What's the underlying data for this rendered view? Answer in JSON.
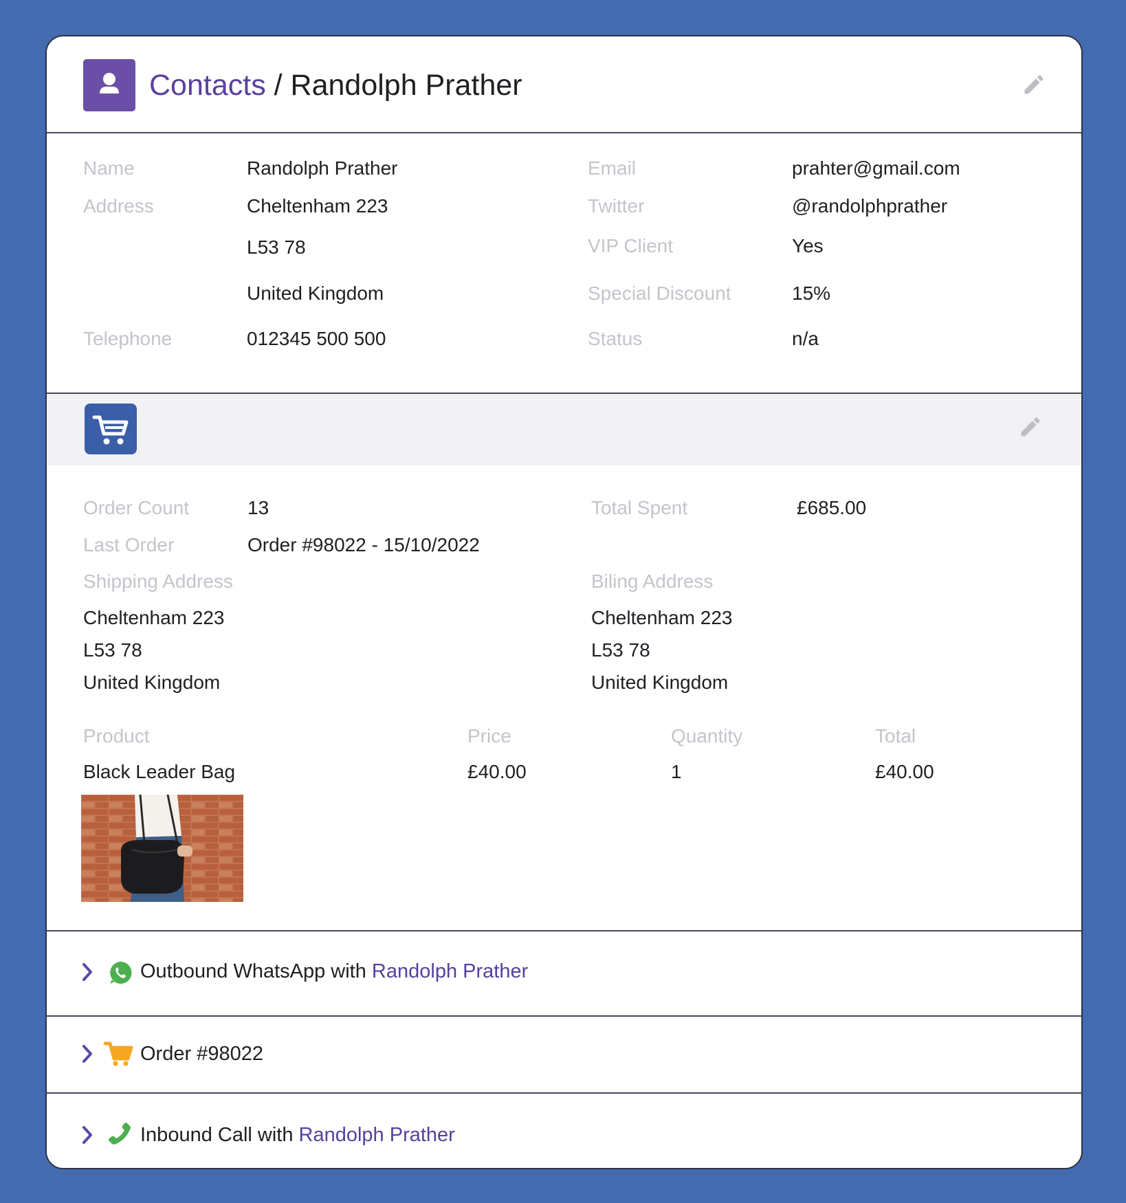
{
  "header": {
    "breadcrumb_root": "Contacts",
    "separator": " / ",
    "contact_name": "Randolph Prather"
  },
  "contact": {
    "name_label": "Name",
    "name_value": "Randolph Prather",
    "address_label": "Address",
    "address_line1": "Cheltenham 223",
    "address_line2": "L53 78",
    "address_line3": "United Kingdom",
    "telephone_label": "Telephone",
    "telephone_value": "012345 500 500",
    "email_label": "Email",
    "email_value": "prahter@gmail.com",
    "twitter_label": "Twitter",
    "twitter_value": "@randolphprather",
    "vip_label": "VIP Client",
    "vip_value": "Yes",
    "discount_label": "Special Discount",
    "discount_value": "15%",
    "status_label": "Status",
    "status_value": "n/a"
  },
  "orders": {
    "order_count_label": "Order Count",
    "order_count_value": "13",
    "last_order_label": "Last Order",
    "last_order_value": "Order #98022 - 15/10/2022",
    "total_spent_label": "Total Spent",
    "total_spent_value": "£685.00",
    "shipping_label": "Shipping Address",
    "shipping_line1": "Cheltenham 223",
    "shipping_line2": "L53 78",
    "shipping_line3": "United Kingdom",
    "billing_label": "Biling Address",
    "billing_line1": "Cheltenham 223",
    "billing_line2": "L53 78",
    "billing_line3": "United Kingdom",
    "table": {
      "headers": {
        "product": "Product",
        "price": "Price",
        "quantity": "Quantity",
        "total": "Total"
      },
      "rows": [
        {
          "product": "Black Leader Bag",
          "price": "£40.00",
          "quantity": "1",
          "total": "£40.00"
        }
      ]
    }
  },
  "activities": [
    {
      "prefix": "Outbound WhatsApp with ",
      "link": "Randolph Prather",
      "icon": "whatsapp-icon"
    },
    {
      "prefix": "Order #98022",
      "link": "",
      "icon": "cart-icon"
    },
    {
      "prefix": "Inbound Call with ",
      "link": "Randolph Prather",
      "icon": "phone-icon"
    }
  ],
  "colors": {
    "background": "#446bb0",
    "brand_purple": "#6b4fa6",
    "link_purple": "#55409c",
    "cart_blue": "#3a5ea8",
    "whatsapp_green": "#4caf50",
    "order_orange": "#f5a623",
    "label_gray": "#c4c4cc"
  }
}
